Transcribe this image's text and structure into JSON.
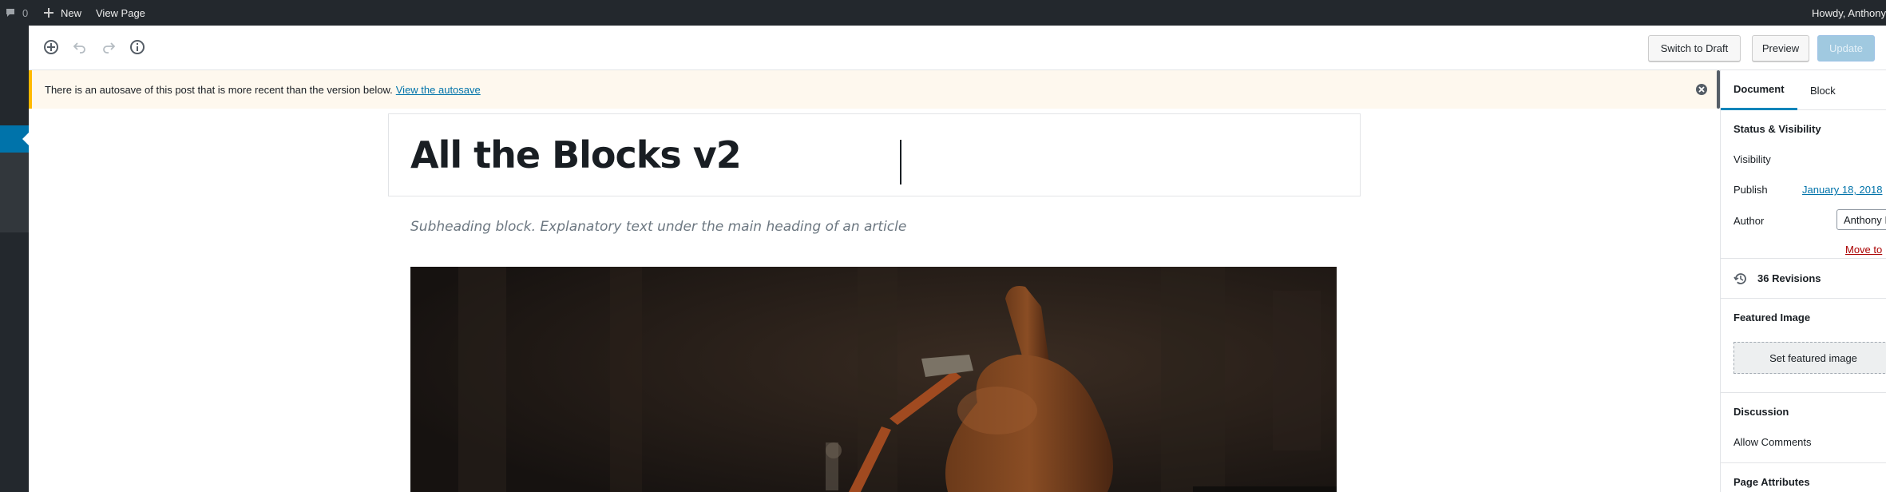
{
  "adminbar": {
    "comments_count": "0",
    "new_label": "New",
    "view_page_label": "View Page",
    "howdy": "Howdy, Anthony"
  },
  "header": {
    "switch_to_draft": "Switch to Draft",
    "preview": "Preview",
    "update": "Update"
  },
  "notice": {
    "message": "There is an autosave of this post that is more recent than the version below.",
    "link": "View the autosave"
  },
  "editor": {
    "title": "All the Blocks v2",
    "subheading": "Subheading block. Explanatory text under the main heading of an article"
  },
  "sidebar": {
    "tabs": [
      "Document",
      "Block"
    ],
    "status_visibility": {
      "title": "Status & Visibility",
      "visibility_label": "Visibility",
      "publish_label": "Publish",
      "publish_value": "January 18, 2018",
      "author_label": "Author",
      "author_value": "Anthony I",
      "move_to_trash": "Move to"
    },
    "revisions": "36 Revisions",
    "featured_image": {
      "title": "Featured Image",
      "button": "Set featured image"
    },
    "discussion": {
      "title": "Discussion",
      "allow_comments": "Allow Comments"
    },
    "page_attributes": {
      "title": "Page Attributes"
    }
  },
  "colors": {
    "adminbar_bg": "#23282d",
    "accent": "#0073aa",
    "notice_bg": "#fef8ee",
    "notice_border": "#ffb900"
  }
}
